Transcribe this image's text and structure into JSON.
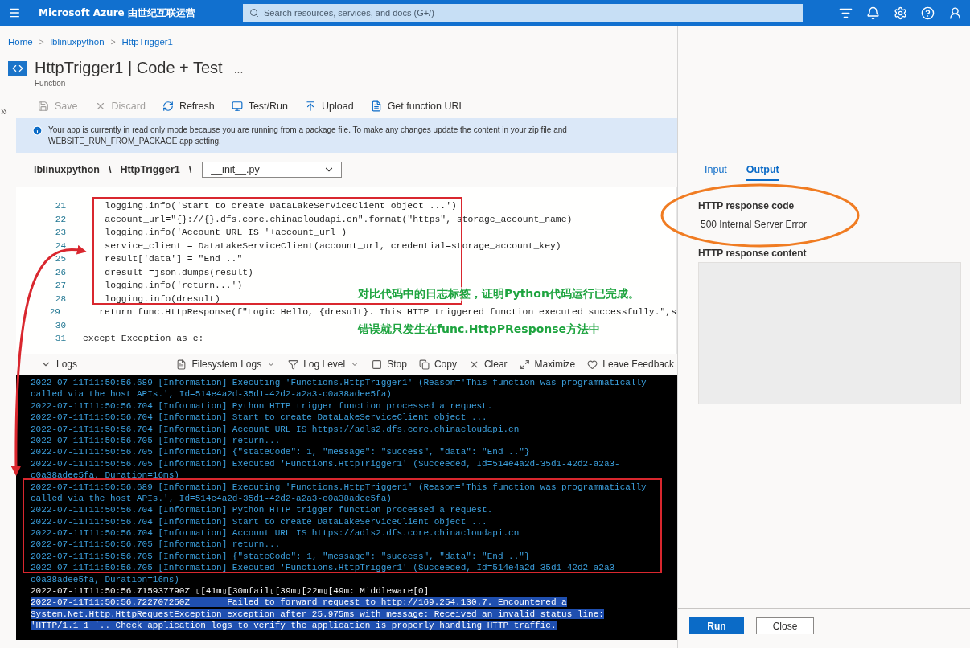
{
  "top_bar": {
    "title": "Microsoft Azure 由世纪互联运营",
    "search": {
      "placeholder": "Search resources, services, and docs (G+/)"
    }
  },
  "breadcrumb": [
    {
      "label": "Home"
    },
    {
      "separator": ">",
      "label": "lblinuxpython"
    },
    {
      "separator": ">",
      "label": "HttpTrigger1"
    }
  ],
  "header": {
    "title": "HttpTrigger1 | Code + Test",
    "more": "...",
    "subtitle": "Function"
  },
  "sidebar_toggle": "»",
  "toolbar": [
    {
      "kind": "save",
      "label": "Save",
      "disabled": true
    },
    {
      "kind": "discard",
      "label": "Discard",
      "disabled": true
    },
    {
      "kind": "refresh",
      "label": "Refresh",
      "disabled": false
    },
    {
      "kind": "test",
      "label": "Test/Run",
      "disabled": false
    },
    {
      "kind": "upload",
      "label": "Upload",
      "disabled": false
    },
    {
      "kind": "url",
      "label": "Get function URL",
      "disabled": false
    }
  ],
  "info_bar": {
    "text": "Your app is currently in read only mode because you are running from a package file. To make any changes update the content in your zip file and WEBSITE_RUN_FROM_PACKAGE app setting."
  },
  "path": {
    "segments": [
      "lblinuxpython",
      "\\",
      "HttpTrigger1",
      "\\"
    ],
    "file": {
      "value": "__init__.py"
    }
  },
  "code_editor": {
    "lines": [
      {
        "number": "21",
        "text": "    logging.info('Start to create DataLakeServiceClient object ...')"
      },
      {
        "number": "22",
        "text": "    account_url=\"{}://{}.dfs.core.chinacloudapi.cn\".format(\"https\", storage_account_name)"
      },
      {
        "number": "23",
        "text": "    logging.info('Account URL IS '+account_url )"
      },
      {
        "number": "24",
        "text": "    service_client = DataLakeServiceClient(account_url, credential=storage_account_key)"
      },
      {
        "number": "25",
        "text": "    result['data'] = \"End ..\""
      },
      {
        "number": "26",
        "text": "    dresult =json.dumps(result)"
      },
      {
        "number": "27",
        "text": "    logging.info('return...')"
      },
      {
        "number": "28",
        "text": "    logging.info(dresult)"
      },
      {
        "number": "29",
        "text": "    return func.HttpResponse(f\"Logic Hello, {dresult}. This HTTP triggered function executed successfully.\",s"
      },
      {
        "number": "30"
      },
      {
        "number": "31",
        "text": "except Exception as e:"
      }
    ]
  },
  "logs": {
    "toolbar": [
      {
        "kind": "collapse",
        "label": "Logs"
      },
      {
        "kind": "filesystem",
        "label": "Filesystem Logs"
      },
      {
        "kind": "level",
        "label": "Log Level"
      },
      {
        "kind": "stop",
        "label": "Stop"
      },
      {
        "kind": "copy",
        "label": "Copy"
      },
      {
        "kind": "clear",
        "label": "Clear"
      },
      {
        "kind": "maximize",
        "label": "Maximize"
      },
      {
        "kind": "feedback",
        "label": "Leave Feedback"
      }
    ],
    "lines": [
      {
        "kind": "info",
        "text": "2022-07-11T11:50:56.689 [Information] Executing 'Functions.HttpTrigger1' (Reason='This function was programmatically"
      },
      {
        "kind": "info",
        "text": "called via the host APIs.', Id=514e4a2d-35d1-42d2-a2a3-c0a38adee5fa)"
      },
      {
        "kind": "info",
        "text": "2022-07-11T11:50:56.704 [Information] Python HTTP trigger function processed a request."
      },
      {
        "kind": "info",
        "text": "2022-07-11T11:50:56.704 [Information] Start to create DataLakeServiceClient object ..."
      },
      {
        "kind": "info",
        "text": "2022-07-11T11:50:56.704 [Information] Account URL IS https://adls2.dfs.core.chinacloudapi.cn"
      },
      {
        "kind": "info",
        "text": "2022-07-11T11:50:56.705 [Information] return..."
      },
      {
        "kind": "info",
        "text": "2022-07-11T11:50:56.705 [Information] {\"stateCode\": 1, \"message\": \"success\", \"data\": \"End ..\"}"
      },
      {
        "kind": "info",
        "text": "2022-07-11T11:50:56.705 [Information] Executed 'Functions.HttpTrigger1' (Succeeded, Id=514e4a2d-35d1-42d2-a2a3-"
      },
      {
        "kind": "info",
        "text": "c0a38adee5fa, Duration=16ms)"
      },
      {
        "kind": "info",
        "text": "2022-07-11T11:50:56.689 [Information] Executing 'Functions.HttpTrigger1' (Reason='This function was programmatically"
      },
      {
        "kind": "info",
        "text": "called via the host APIs.', Id=514e4a2d-35d1-42d2-a2a3-c0a38adee5fa)"
      },
      {
        "kind": "info",
        "text": "2022-07-11T11:50:56.704 [Information] Python HTTP trigger function processed a request."
      },
      {
        "kind": "info",
        "text": "2022-07-11T11:50:56.704 [Information] Start to create DataLakeServiceClient object ..."
      },
      {
        "kind": "info",
        "text": "2022-07-11T11:50:56.704 [Information] Account URL IS https://adls2.dfs.core.chinacloudapi.cn"
      },
      {
        "kind": "info",
        "text": "2022-07-11T11:50:56.705 [Information] return..."
      },
      {
        "kind": "info",
        "text": "2022-07-11T11:50:56.705 [Information] {\"stateCode\": 1, \"message\": \"success\", \"data\": \"End ..\"}"
      },
      {
        "kind": "info",
        "text": "2022-07-11T11:50:56.705 [Information] Executed 'Functions.HttpTrigger1' (Succeeded, Id=514e4a2d-35d1-42d2-a2a3-"
      },
      {
        "kind": "info",
        "text": "c0a38adee5fa, Duration=16ms)"
      },
      {
        "kind": "plain",
        "text": "2022-07-11T11:50:56.715937790Z ▯[41m▯[30mfail▯[39m▯[22m▯[49m: Middleware[0]"
      },
      {
        "kind": "highlighted",
        "text": "2022-07-11T11:50:56.722707250Z       Failed to forward request to http://169.254.130.7. Encountered a"
      },
      {
        "kind": "highlighted",
        "text": "System.Net.Http.HttpRequestException exception after 25.975ms with message: Received an invalid status line:"
      },
      {
        "kind": "highlighted",
        "text": "'HTTP/1.1 1 '.. Check application logs to verify the application is properly handling HTTP traffic."
      }
    ]
  },
  "test_panel": {
    "tabs": [
      {
        "label": "Input",
        "selected": false
      },
      {
        "label": "Output",
        "selected": true
      }
    ],
    "response_code": {
      "label": "HTTP response code",
      "value": "500 Internal Server Error"
    },
    "response_content": {
      "label": "HTTP response content"
    },
    "buttons": [
      {
        "kind": "primary",
        "label": "Run"
      },
      {
        "kind": "secondary",
        "label": "Close"
      }
    ]
  },
  "annotations": {
    "notes": [
      "对比代码中的日志标签，证明Python代码运行已完成。",
      "错误就只发生在func.HttpPResponse方法中"
    ]
  }
}
